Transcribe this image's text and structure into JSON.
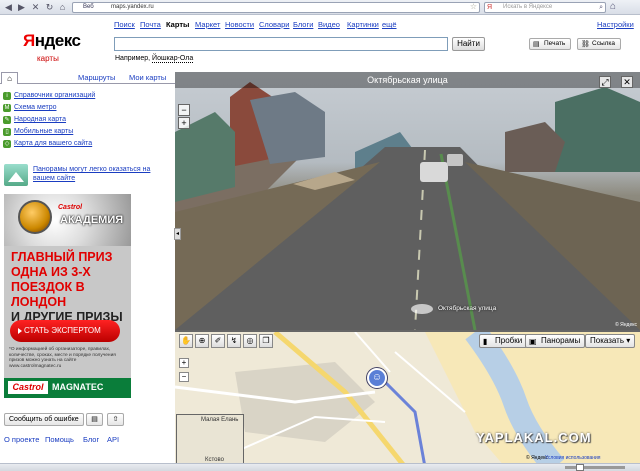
{
  "browser": {
    "tab_tag": "Веб",
    "url": "maps.yandex.ru",
    "search_placeholder": "Искать в Яндексе"
  },
  "logo": {
    "y": "Я",
    "rest": "ндекс",
    "sub": "карты"
  },
  "services": [
    "Поиск",
    "Почта",
    "Карты",
    "Маркет",
    "Новости",
    "Словари",
    "Блоги",
    "Видео",
    "Картинки",
    "ещё"
  ],
  "settings": "Настройки",
  "search": {
    "find_label": "Найти",
    "example_prefix": "Например,",
    "example_link": "Йошкар-Ола"
  },
  "top_buttons": {
    "print": "Печать",
    "link": "Ссылка"
  },
  "tabs": {
    "routes": "Маршруты",
    "my_maps": "Мои карты"
  },
  "links": [
    "Справочник организаций",
    "Схема метро",
    "Народная карта",
    "Мобильные карты",
    "Карта для вашего сайта"
  ],
  "pano_promo": "Панорамы могут легко оказаться на вашем сайте",
  "ad": {
    "brand": "Castrol",
    "brand_sub": "АКАДЕМИЯ",
    "prize_lines": [
      "ГЛАВНЫЙ ПРИЗ",
      "ОДНА ИЗ 3-Х",
      "ПОЕЗДОК В ЛОНДОН",
      "И ДРУГИЕ ПРИЗЫ"
    ],
    "cta": "СТАТЬ ЭКСПЕРТОМ",
    "fine_print": "*О информацией об организаторе, правилах, количестве, сроках, месте и порядке получения призов можно узнать на сайте www.castrolmagnatec.ru",
    "logo_left": "Castrol",
    "logo_right": "MAGNATEC"
  },
  "report_error": "Сообщить об ошибке",
  "footer": [
    "О проекте",
    "Помощь",
    "Блог",
    "API"
  ],
  "panorama": {
    "title": "Октябрьская улица",
    "street_label": "Октябрьская улица",
    "copyright": "© Яндекс"
  },
  "map": {
    "traffic": "Пробки",
    "panoramas": "Панорамы",
    "show": "Показать ▾",
    "labels": [
      "Малая Елань",
      "Кстово"
    ],
    "copy_prefix": "© Яндекс",
    "terms": "Условия использования"
  },
  "watermark": "YAPLAKAL.COM",
  "colors": {
    "link": "#1a3dc1",
    "brand_red": "#e00000",
    "ad_green": "#0a7d3a"
  }
}
